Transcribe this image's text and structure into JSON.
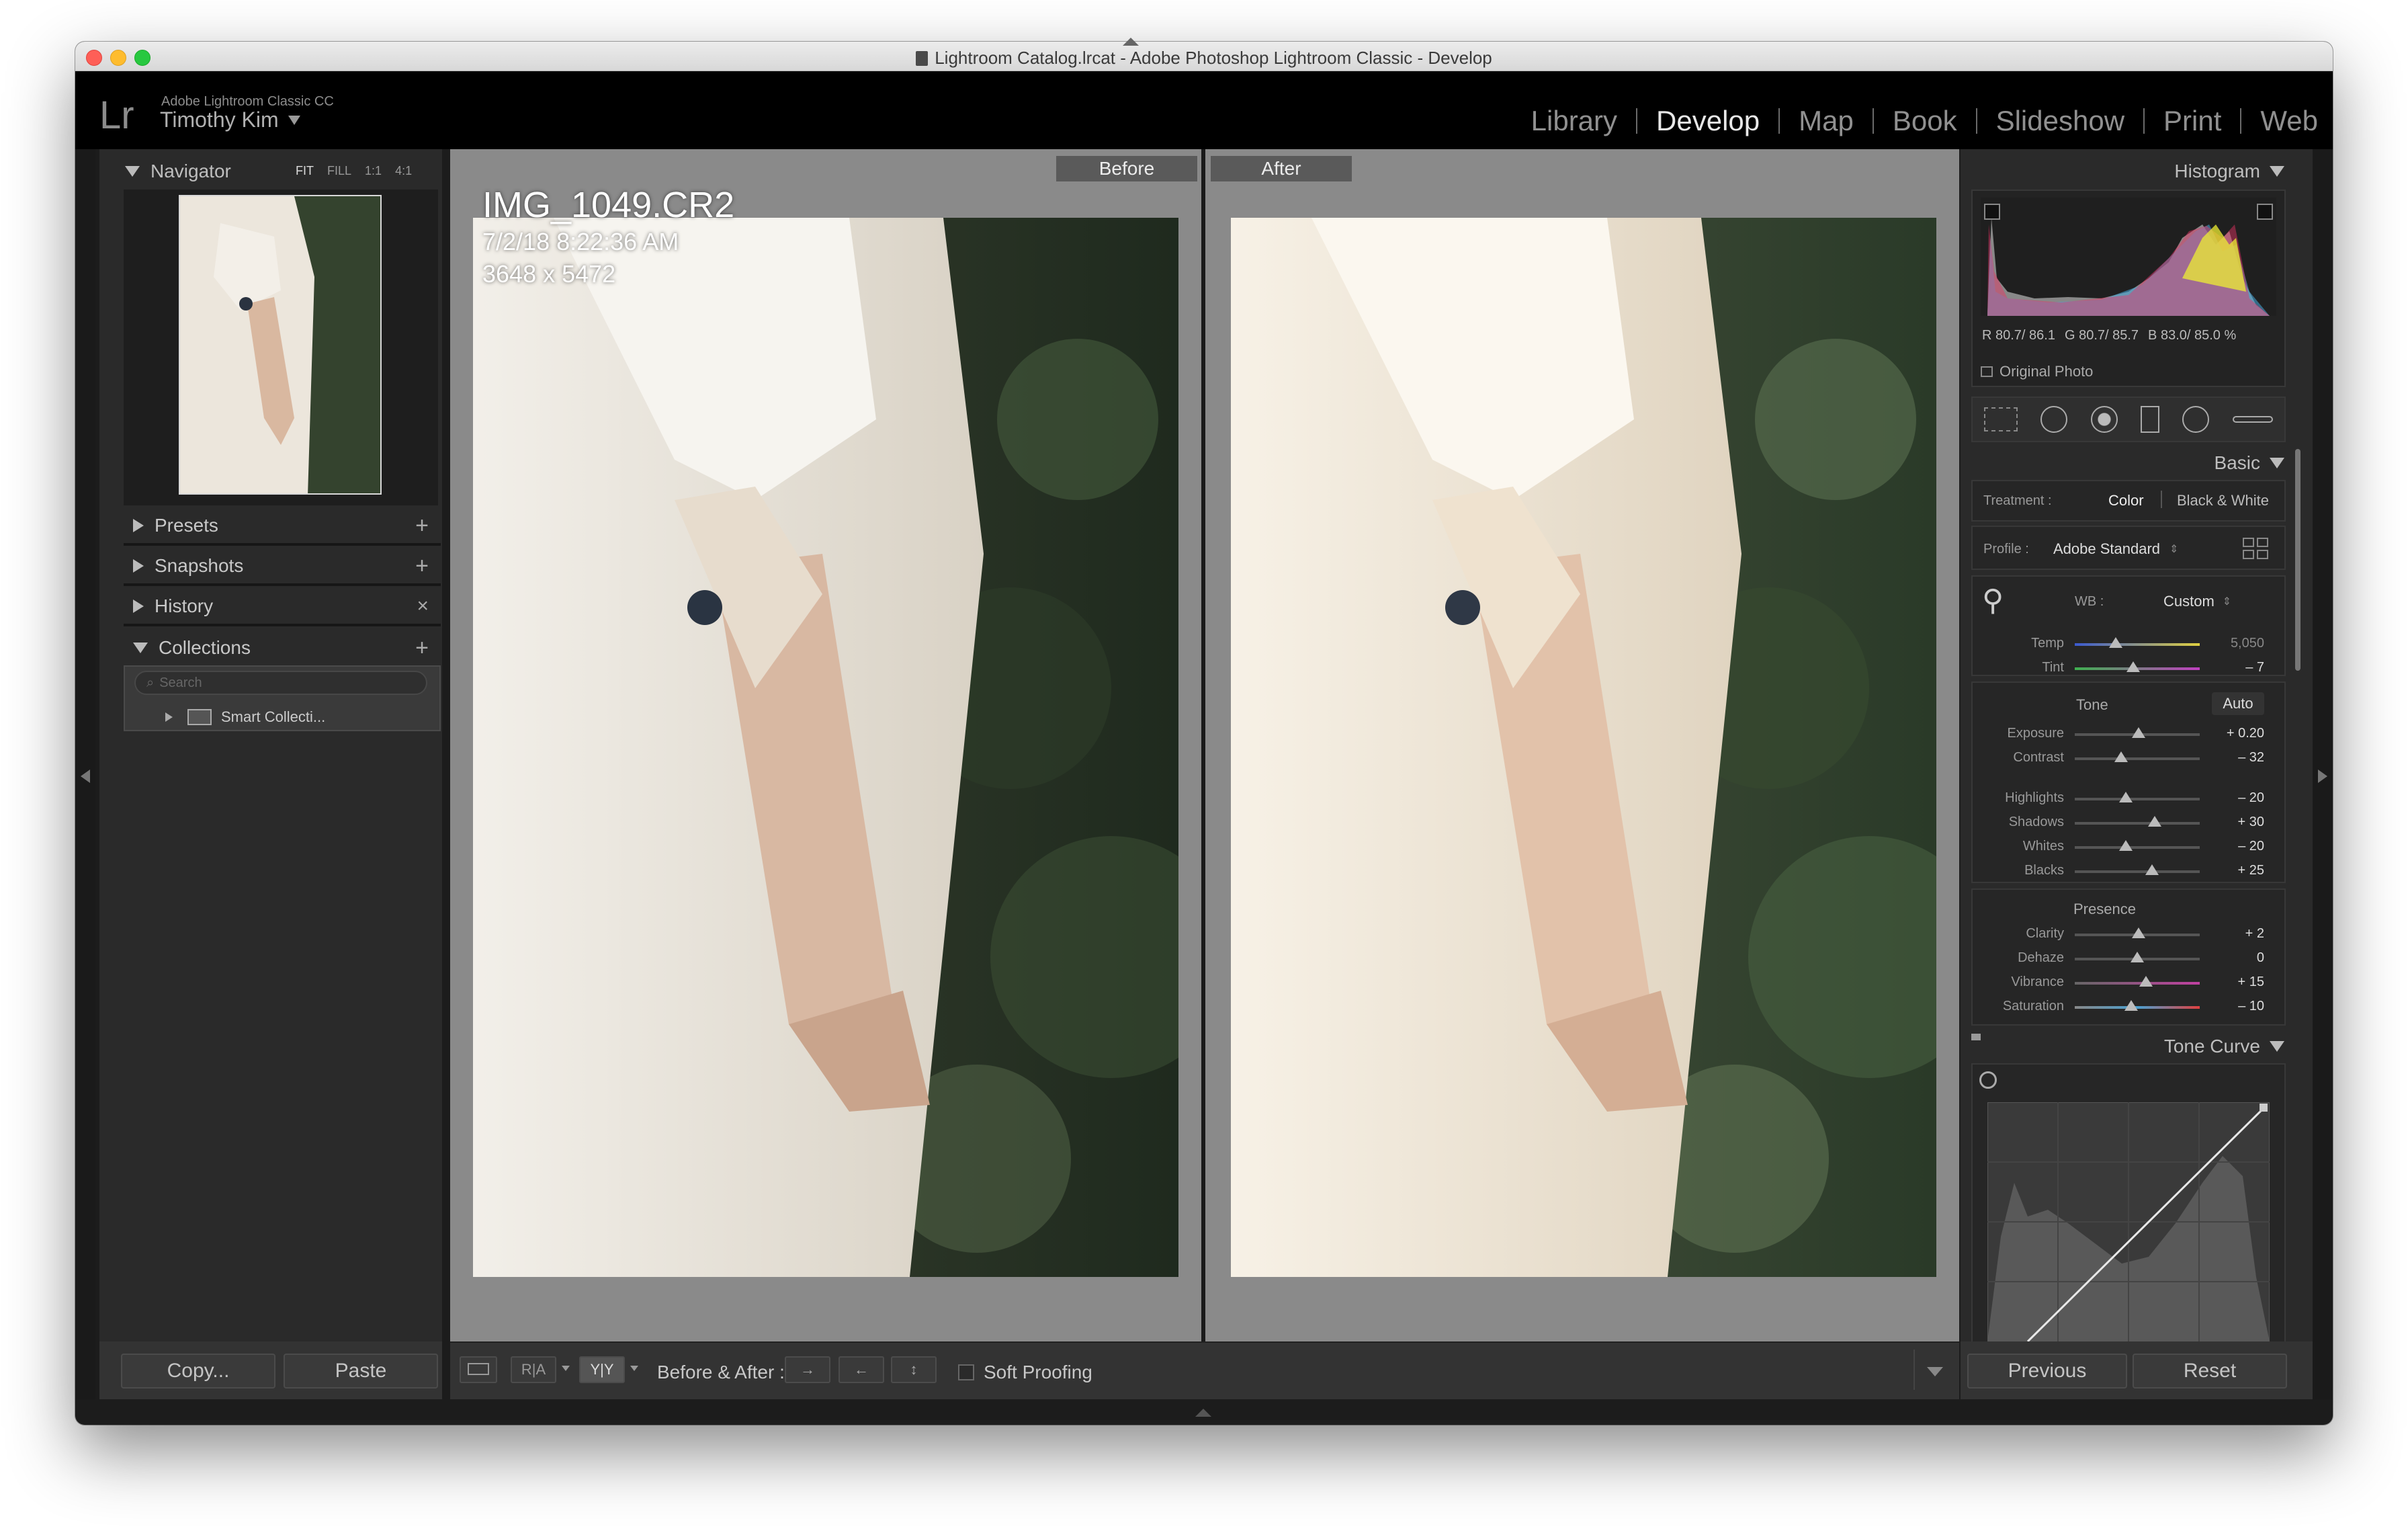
{
  "window": {
    "title": "Lightroom Catalog.lrcat - Adobe Photoshop Lightroom Classic - Develop"
  },
  "identity": {
    "logo": "Lr",
    "product": "Adobe Lightroom Classic CC",
    "user": "Timothy Kim"
  },
  "modules": [
    "Library",
    "Develop",
    "Map",
    "Book",
    "Slideshow",
    "Print",
    "Web"
  ],
  "active_module": "Develop",
  "navigator": {
    "title": "Navigator",
    "options": [
      "FIT",
      "FILL",
      "1:1",
      "4:1"
    ]
  },
  "left_panels": {
    "presets": "Presets",
    "snapshots": "Snapshots",
    "history": "History",
    "collections": "Collections",
    "search_placeholder": "Search",
    "smart_collection": "Smart Collecti..."
  },
  "left_buttons": {
    "copy": "Copy...",
    "paste": "Paste"
  },
  "viewer": {
    "before_label": "Before",
    "after_label": "After",
    "filename": "IMG_1049.CR2",
    "datetime": "7/2/18 8:22:36 AM",
    "dimensions": "3648 x 5472"
  },
  "toolbar": {
    "before_after_label": "Before & After :",
    "soft_proofing": "Soft Proofing",
    "view_ra": "R|A",
    "view_yy": "Y|Y"
  },
  "histogram": {
    "title": "Histogram",
    "r": "R 80.7/ 86.1",
    "g": "G 80.7/ 85.7",
    "b": "B 83.0/ 85.0 %",
    "original_photo": "Original Photo"
  },
  "basic": {
    "title": "Basic",
    "treatment_label": "Treatment :",
    "treatment_color": "Color",
    "treatment_bw": "Black & White",
    "profile_label": "Profile :",
    "profile_value": "Adobe Standard",
    "wb_label": "WB :",
    "wb_value": "Custom",
    "tone_label": "Tone",
    "auto_label": "Auto",
    "presence_label": "Presence",
    "sliders": [
      {
        "label": "Temp",
        "value": "5,050",
        "pos": 0.33
      },
      {
        "label": "Tint",
        "value": "– 7",
        "pos": 0.47
      },
      {
        "label": "Exposure",
        "value": "+ 0.20",
        "pos": 0.51
      },
      {
        "label": "Contrast",
        "value": "– 32",
        "pos": 0.37
      },
      {
        "label": "Highlights",
        "value": "– 20",
        "pos": 0.41
      },
      {
        "label": "Shadows",
        "value": "+ 30",
        "pos": 0.64
      },
      {
        "label": "Whites",
        "value": "– 20",
        "pos": 0.41
      },
      {
        "label": "Blacks",
        "value": "+ 25",
        "pos": 0.62
      },
      {
        "label": "Clarity",
        "value": "+ 2",
        "pos": 0.51
      },
      {
        "label": "Dehaze",
        "value": "0",
        "pos": 0.5
      },
      {
        "label": "Vibrance",
        "value": "+ 15",
        "pos": 0.57
      },
      {
        "label": "Saturation",
        "value": "– 10",
        "pos": 0.45
      }
    ]
  },
  "tone_curve": {
    "title": "Tone Curve"
  },
  "right_buttons": {
    "previous": "Previous",
    "reset": "Reset"
  },
  "colors": {
    "active_module": "#e8e8e8",
    "inactive_module": "#909090",
    "panel_bg": "#2b2b2b",
    "viewer_bg": "#8a8a8a"
  }
}
